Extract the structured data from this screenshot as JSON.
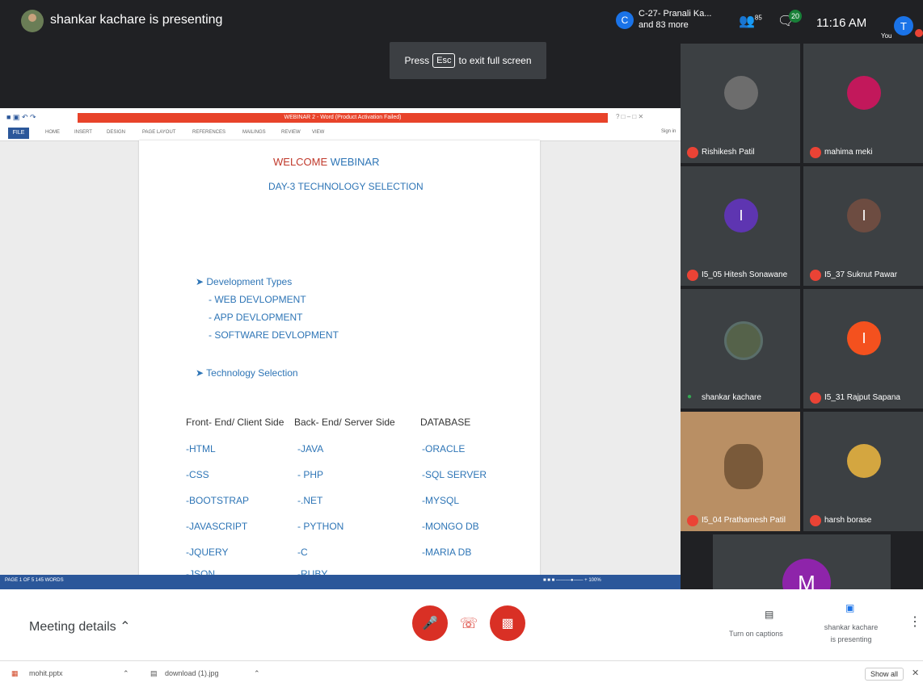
{
  "topbar": {
    "presenting": "shankar kachare is presenting",
    "fullscreen_prefix": "Press",
    "fullscreen_key": "Esc",
    "fullscreen_suffix": "to exit full screen",
    "tile_initial": "C",
    "tile_name_line1": "C-27- Pranali Ka...",
    "tile_name_line2": "and 83 more",
    "people_count": "85",
    "chat_badge": "20",
    "clock": "11:16 AM",
    "you_label": "You",
    "self_initial": "T"
  },
  "word": {
    "title": "WEBINAR 2 - Word (Product Activation Failed)",
    "ribbon_tabs": [
      "FILE",
      "HOME",
      "INSERT",
      "DESIGN",
      "PAGE LAYOUT",
      "REFERENCES",
      "MAILINGS",
      "REVIEW",
      "VIEW"
    ],
    "sign_in": "Sign in",
    "status_left": "PAGE 1 OF 5   145 WORDS",
    "status_zoom": "100%",
    "doc": {
      "welcome_1": "WELCOME",
      "welcome_2": "WEBINAR",
      "day3": "DAY-3 TECHNOLOGY SELECTION",
      "dev_types": "➤ Development Types",
      "dev_items": [
        "-  WEB DEVLOPMENT",
        "-  APP DEVLOPMENT",
        "-  SOFTWARE DEVLOPMENT"
      ],
      "tech_sel": "➤ Technology Selection",
      "headers": [
        "Front- End/ Client Side",
        "Back- End/ Server Side",
        "DATABASE"
      ],
      "front": [
        "-HTML",
        "-CSS",
        "-BOOTSTRAP",
        "-JAVASCRIPT",
        "-JQUERY",
        "-JSON"
      ],
      "back": [
        "-JAVA",
        "- PHP",
        "-.NET",
        "- PYTHON",
        "-C",
        "-RUBY"
      ],
      "db": [
        "-ORACLE",
        "-SQL SERVER",
        "-MYSQL",
        "-MONGO DB",
        "-MARIA DB"
      ]
    }
  },
  "participants": [
    {
      "name": "Rishikesh Patil",
      "initial": "",
      "color": "#6d6d6d"
    },
    {
      "name": "mahima meki",
      "initial": "",
      "color": "#c2185b"
    },
    {
      "name": "I5_05 Hitesh Sonawane",
      "initial": "I",
      "color": "#5e35b1"
    },
    {
      "name": "I5_37 Suknut Pawar",
      "initial": "I",
      "color": "#6d4c41"
    },
    {
      "name": "shankar kachare",
      "initial": "",
      "color": "#55624a"
    },
    {
      "name": "I5_31 Rajput Sapana",
      "initial": "I",
      "color": "#f4511e"
    },
    {
      "name": "I5_04 Prathamesh Patil",
      "initial": "",
      "color": "#b98f64"
    },
    {
      "name": "harsh borase",
      "initial": "",
      "color": "#d4a640"
    },
    {
      "name": "M",
      "initial": "M",
      "color": "#8e24aa"
    }
  ],
  "bottombar": {
    "meeting_details": "Meeting details",
    "captions_label": "Turn on captions",
    "present_line1": "shankar kachare",
    "present_line2": "is presenting"
  },
  "downloads": {
    "file1": "mohit.pptx",
    "file2": "download (1).jpg",
    "show_all": "Show all"
  }
}
